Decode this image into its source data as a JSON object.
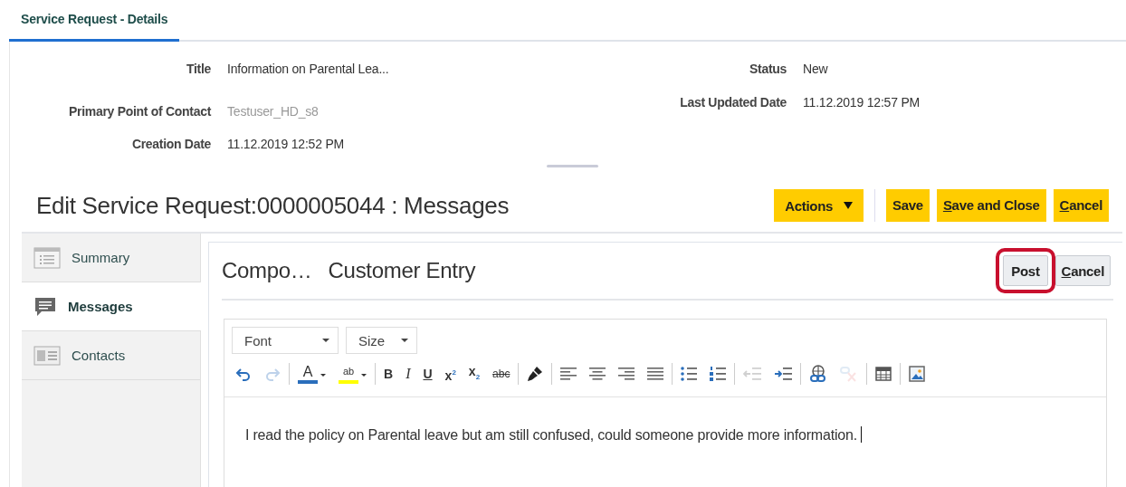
{
  "tab": {
    "label": "Service Request - Details",
    "selected": true
  },
  "details": {
    "left": [
      {
        "label": "Title",
        "value": "Information on Parental Lea...",
        "muted": false
      },
      {
        "label": "Primary Point of Contact",
        "value": "Testuser_HD_s8",
        "muted": true
      },
      {
        "label": "Creation Date",
        "value": "11.12.2019 12:52 PM",
        "muted": false
      }
    ],
    "right": [
      {
        "label": "Status",
        "value": "New",
        "muted": false
      },
      {
        "label": "Last Updated Date",
        "value": "11.12.2019 12:57 PM",
        "muted": false
      }
    ]
  },
  "page_title": "Edit Service Request:0000005044 : Messages",
  "actions": [
    {
      "label": "Actions",
      "kind": "menu"
    },
    {
      "label": "Save",
      "kind": "button",
      "mnemonic": false
    },
    {
      "label": "Save and Close",
      "kind": "button",
      "mnemonic": true
    },
    {
      "label": "Cancel",
      "kind": "button",
      "mnemonic": true
    }
  ],
  "nav": [
    {
      "label": "Summary",
      "selected": false
    },
    {
      "label": "Messages",
      "selected": true
    },
    {
      "label": "Contacts",
      "selected": false
    }
  ],
  "compose": {
    "title_prefix": "Compo…",
    "title": "Customer Entry",
    "buttons": [
      {
        "label": "Post",
        "highlighted": true
      },
      {
        "label": "Cancel",
        "highlighted": false,
        "mnemonic": true
      }
    ]
  },
  "editor": {
    "font": {
      "placeholder": "Font"
    },
    "size": {
      "placeholder": "Size"
    },
    "toolbar": [
      {
        "kind": "undo",
        "disabled": false
      },
      {
        "kind": "redo",
        "disabled": true
      },
      {
        "kind": "separator"
      },
      {
        "kind": "textcolor",
        "label": "A",
        "color": "#2a6ebb"
      },
      {
        "kind": "highlight",
        "label": "ab",
        "color": "#ffff00"
      },
      {
        "kind": "separator"
      },
      {
        "kind": "bold",
        "label": "B"
      },
      {
        "kind": "italic",
        "label": "I"
      },
      {
        "kind": "underline",
        "label": "U"
      },
      {
        "kind": "superscript",
        "label": "x$^{2}$"
      },
      {
        "kind": "subscript",
        "label": "x$_{2}$"
      },
      {
        "kind": "strikethrough",
        "label": "abc"
      },
      {
        "kind": "separator"
      },
      {
        "kind": "brush",
        "disabled": false
      },
      {
        "kind": "separator"
      },
      {
        "kind": "alignleft",
        "disabled": false
      },
      {
        "kind": "aligncenter",
        "disabled": false
      },
      {
        "kind": "alignright",
        "disabled": false
      },
      {
        "kind": "justify",
        "disabled": false
      },
      {
        "kind": "separator"
      },
      {
        "kind": "bullets",
        "disabled": false
      },
      {
        "kind": "numbers",
        "disabled": false
      },
      {
        "kind": "separator"
      },
      {
        "kind": "outdent",
        "disabled": true
      },
      {
        "kind": "indent",
        "disabled": false
      },
      {
        "kind": "separator"
      },
      {
        "kind": "link",
        "disabled": false
      },
      {
        "kind": "unlink",
        "disabled": true
      },
      {
        "kind": "separator"
      },
      {
        "kind": "table",
        "disabled": false
      },
      {
        "kind": "separator"
      },
      {
        "kind": "image",
        "disabled": false
      }
    ],
    "text": "I read the policy on Parental leave but am still confused, could someone provide more information."
  }
}
